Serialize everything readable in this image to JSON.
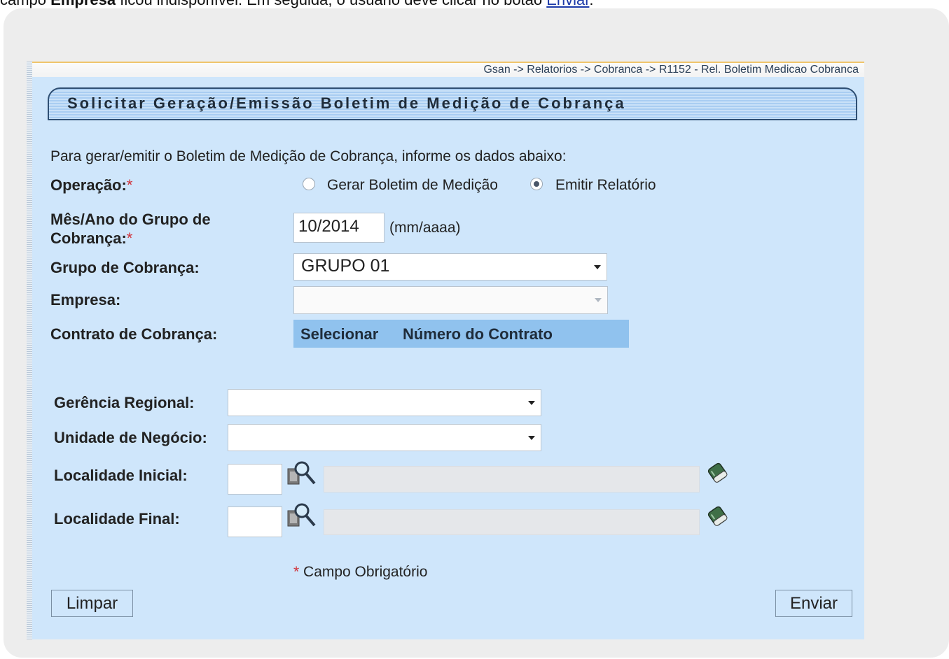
{
  "caption": {
    "prefix": "campo ",
    "bold": "Empresa",
    "middle": " ficou indisponível. Em seguida, o usuário deve clicar no botão ",
    "link": "Enviar",
    "suffix": "."
  },
  "breadcrumb": "Gsan -> Relatorios -> Cobranca -> R1152 - Rel. Boletim Medicao Cobranca",
  "title": "Solicitar Geração/Emissão Boletim de Medição de Cobrança",
  "intro": "Para gerar/emitir o Boletim de Medição de Cobrança, informe os dados abaixo:",
  "operation": {
    "label": "Operação:",
    "required_mark": "*",
    "options": [
      "Gerar Boletim de Medição",
      "Emitir Relatório"
    ],
    "selected": "Emitir Relatório"
  },
  "month_year": {
    "label_line1": "Mês/Ano do Grupo de",
    "label_line2": "Cobrança:",
    "required_mark": "*",
    "value": "10/2014",
    "hint": "(mm/aaaa)"
  },
  "billing_group": {
    "label": "Grupo de Cobrança:",
    "value": "GRUPO 01"
  },
  "company": {
    "label": "Empresa:",
    "value": ""
  },
  "contract": {
    "label": "Contrato de Cobrança:",
    "col1": "Selecionar",
    "col2": "Número do Contrato"
  },
  "regional": {
    "label": "Gerência Regional:",
    "value": ""
  },
  "business_unit": {
    "label": "Unidade de Negócio:",
    "value": ""
  },
  "locality_start": {
    "label": "Localidade Inicial:",
    "code": "",
    "name": ""
  },
  "locality_end": {
    "label": "Localidade Final:",
    "code": "",
    "name": ""
  },
  "required_note": {
    "mark": "*",
    "text": "Campo Obrigatório"
  },
  "buttons": {
    "clear": "Limpar",
    "submit": "Enviar"
  },
  "colors": {
    "panel": "#cfe6fb",
    "title_bar": "#a9cdf2",
    "contract_header": "#90c2ee",
    "required": "#d0323a"
  },
  "icons": [
    "search-icon",
    "eraser-icon"
  ]
}
